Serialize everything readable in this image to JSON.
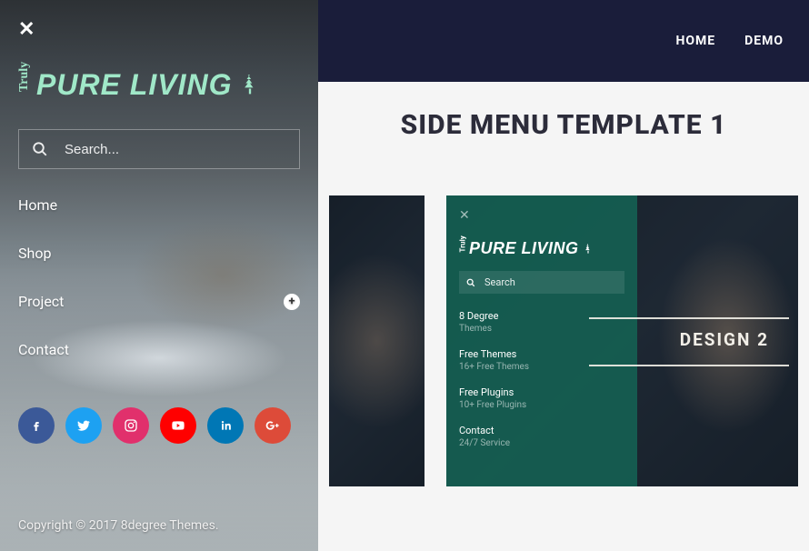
{
  "sidebar": {
    "logo_prefix": "Truly",
    "logo_main": "PURE LIVING",
    "search_placeholder": "Search...",
    "nav": [
      {
        "label": "Home",
        "expandable": false
      },
      {
        "label": "Shop",
        "expandable": false
      },
      {
        "label": "Project",
        "expandable": true
      },
      {
        "label": "Contact",
        "expandable": false
      }
    ],
    "socials": [
      "facebook",
      "twitter",
      "instagram",
      "youtube",
      "linkedin",
      "google-plus"
    ],
    "copyright": "Copyright © 2017 8degree Themes."
  },
  "topbar": {
    "links": [
      "HOME",
      "DEMO"
    ]
  },
  "page": {
    "title": "SIDE MENU TEMPLATE 1"
  },
  "cards": {
    "design2": {
      "label": "DESIGN 2",
      "mini_logo_prefix": "Truly",
      "mini_logo_main": "PURE LIVING",
      "mini_search_placeholder": "Search",
      "items": [
        {
          "title": "8 Degree",
          "sub": "Themes"
        },
        {
          "title": "Free Themes",
          "sub": "16+ Free Themes"
        },
        {
          "title": "Free Plugins",
          "sub": "10+ Free Plugins"
        },
        {
          "title": "Contact",
          "sub": "24/7 Service"
        }
      ]
    }
  }
}
